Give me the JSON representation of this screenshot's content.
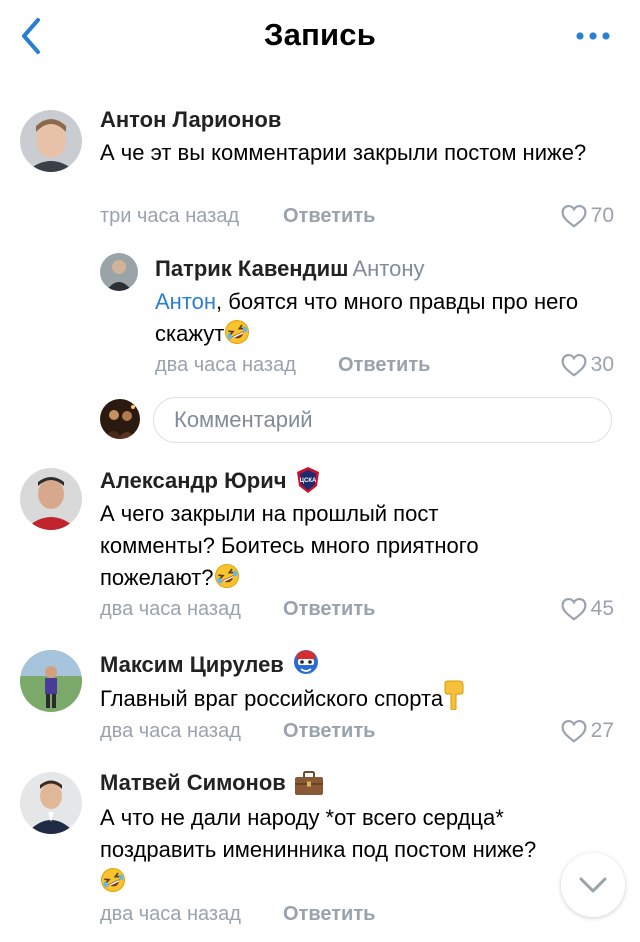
{
  "header": {
    "title": "Запись"
  },
  "comments": [
    {
      "author": "Антон Ларионов",
      "text": "А че эт вы комментарии закрыли постом ниже?",
      "time": "три часа назад",
      "reply_label": "Ответить",
      "likes": "70",
      "replies": [
        {
          "author": "Патрик Кавендиш",
          "reply_to": "Антону",
          "mention": "Антон",
          "text": ", боятся что много правды про него скажут",
          "time": "два часа назад",
          "reply_label": "Ответить",
          "likes": "30"
        }
      ],
      "input_placeholder": "Комментарий"
    },
    {
      "author": "Александр Юрич",
      "text_line1": "А чего закрыли на прошлый пост",
      "text_line2": "комменты? Боитесь много приятного",
      "text_line3": "пожелают?",
      "time": "два часа назад",
      "reply_label": "Ответить",
      "likes": "45"
    },
    {
      "author": "Максим Цирулев",
      "text": "Главный враг российского спорта",
      "time": "два часа назад",
      "reply_label": "Ответить",
      "likes": "27"
    },
    {
      "author": "Матвей Симонов",
      "text_line1": "А что не дали народу *от всего сердца*",
      "text_line2": "поздравить именинника под постом ниже?",
      "time": "два часа назад",
      "reply_label": "Ответить"
    }
  ],
  "icons": {
    "back": "chevron-left-icon",
    "more": "more-dots-icon",
    "like": "heart-icon",
    "scroll": "chevron-down-icon",
    "laugh": "rolling-laughing-emoji",
    "point_down": "pointing-down-emoji",
    "briefcase": "briefcase-emoji",
    "cska": "cska-badge",
    "captain": "captain-shield-badge"
  },
  "colors": {
    "accent": "#2a7fd4",
    "secondary": "#99a2ad",
    "divider": "#dce1e6"
  }
}
